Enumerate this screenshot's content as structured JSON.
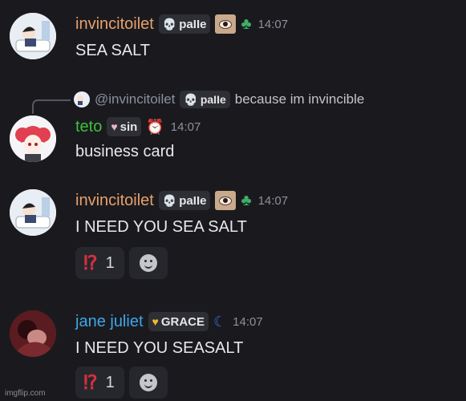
{
  "messages": [
    {
      "username": "invincitoilet",
      "username_color": "#e8a06a",
      "tag_icon": "skull-icon",
      "tag_text": "paIIe",
      "badges": [
        "eye-icon",
        "clover-icon"
      ],
      "timestamp": "14:07",
      "text": "SEA SALT"
    },
    {
      "reply": {
        "mention": "@invincitoilet",
        "tag_text": "paIIe",
        "text": "because im invincible"
      },
      "username": "teto",
      "username_color": "#3fbf3f",
      "tag_icon": "heart-icon",
      "tag_text": "sin",
      "badges": [
        "alarm-clock-icon"
      ],
      "timestamp": "14:07",
      "text": "business card"
    },
    {
      "username": "invincitoilet",
      "username_color": "#e8a06a",
      "tag_icon": "skull-icon",
      "tag_text": "paIIe",
      "badges": [
        "eye-icon",
        "clover-icon"
      ],
      "timestamp": "14:07",
      "text": "I NEED YOU SEA SALT",
      "reactions": [
        {
          "emoji": "⁉",
          "count": "1"
        }
      ]
    },
    {
      "username": "jane juliet",
      "username_color": "#3fa6e8",
      "tag_icon": "heart-icon",
      "tag_text": "GRACE",
      "badges": [
        "moon-icon"
      ],
      "timestamp": "14:07",
      "text": "I NEED YOU SEASALT",
      "reactions": [
        {
          "emoji": "⁉",
          "count": "1"
        }
      ]
    }
  ],
  "watermark": "imgflip.com"
}
